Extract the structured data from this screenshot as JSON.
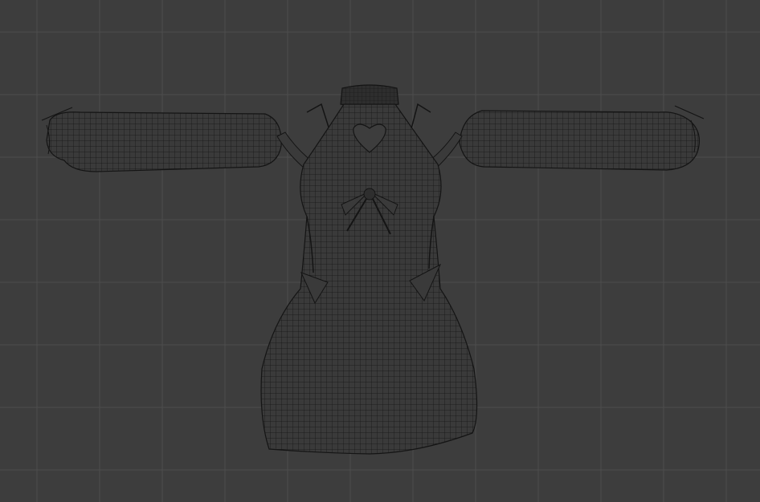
{
  "viewport": {
    "mode": "wireframe",
    "object": "dress-mesh",
    "background_color": "#3d3d3d",
    "grid_color": "#4d4d4d",
    "grid_major_color": "#555555",
    "mesh_fill_color": "#3a3a3a",
    "wire_color": "#141414"
  }
}
